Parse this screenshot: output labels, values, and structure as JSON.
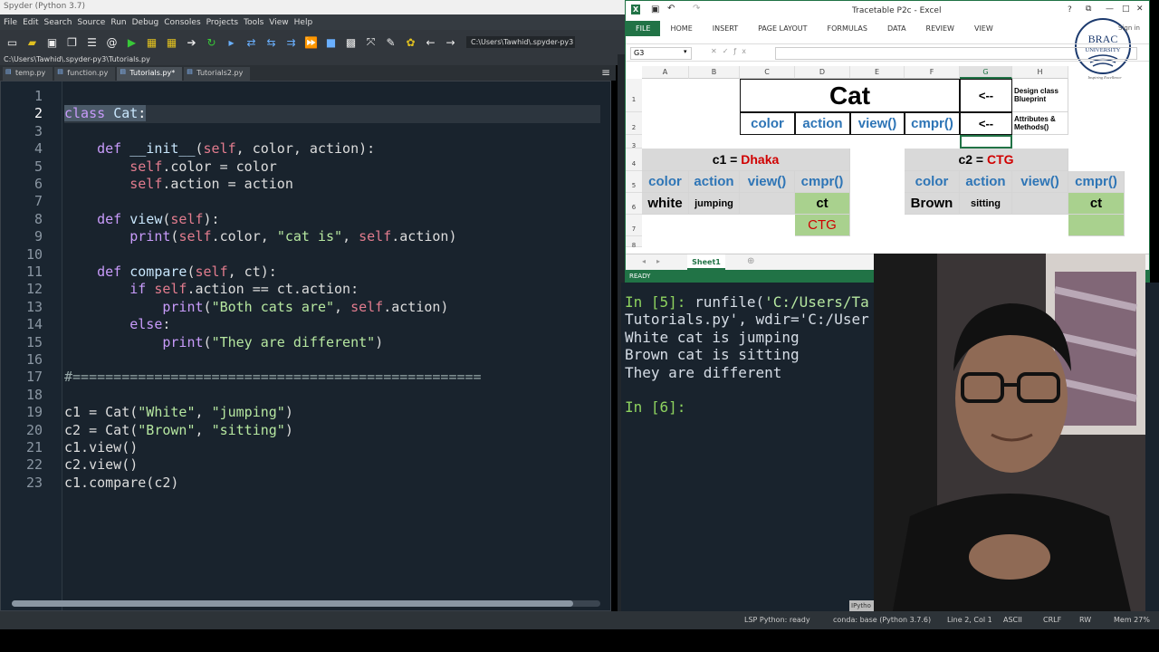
{
  "spyder": {
    "title": "Spyder (Python 3.7)",
    "menu": [
      "File",
      "Edit",
      "Search",
      "Source",
      "Run",
      "Debug",
      "Consoles",
      "Projects",
      "Tools",
      "View",
      "Help"
    ],
    "path_box": "C:\\Users\\Tawhid\\.spyder-py3",
    "file_path": "C:\\Users\\Tawhid\\.spyder-py3\\Tutorials.py",
    "tabs": [
      "temp.py",
      "function.py",
      "Tutorials.py*",
      "Tutorials2.py"
    ],
    "active_tab": 2,
    "code_lines": [
      "",
      "class Cat:",
      "",
      "    def __init__(self, color, action):",
      "        self.color = color",
      "        self.action = action",
      "",
      "    def view(self):",
      "        print(self.color, \"cat is\", self.action)",
      "",
      "    def compare(self, ct):",
      "        if self.action == ct.action:",
      "            print(\"Both cats are\", self.action)",
      "        else:",
      "            print(\"They are different\")",
      "",
      "#==================================================",
      "",
      "c1 = Cat(\"White\", \"jumping\")",
      "c2 = Cat(\"Brown\", \"sitting\")",
      "c1.view()",
      "c2.view()",
      "c1.compare(c2)"
    ],
    "current_line": 2,
    "status": {
      "lsp": "LSP Python: ready",
      "conda": "conda: base (Python 3.7.6)",
      "position": "Line 2, Col 1",
      "encoding": "ASCII",
      "eol": "CRLF",
      "rw": "RW",
      "mem": "Mem 27%"
    }
  },
  "excel": {
    "title": "Tracetable P2c - Excel",
    "signin": "Sign in",
    "ribbon": [
      "FILE",
      "HOME",
      "INSERT",
      "PAGE LAYOUT",
      "FORMULAS",
      "DATA",
      "REVIEW",
      "VIEW"
    ],
    "namebox": "G3",
    "columns": [
      "A",
      "B",
      "C",
      "D",
      "E",
      "F",
      "G",
      "H"
    ],
    "selected_column": "G",
    "rows": [
      "1",
      "2",
      "3",
      "4",
      "5",
      "6",
      "7",
      "8"
    ],
    "cells": {
      "cat": "Cat",
      "arrow1": "<--",
      "arrow2": "<--",
      "design": "Design class Blueprint",
      "attrs": "Attributes & Methods()",
      "color": "color",
      "action": "action",
      "view": "view()",
      "cmpr": "cmpr()",
      "c1_prefix": "c1 = ",
      "c1_city": "Dhaka",
      "c2_prefix": "c2 = ",
      "c2_city": "CTG",
      "white": "white",
      "jumping": "jumping",
      "ct": "ct",
      "ctg": "CTG",
      "brown": "Brown",
      "sitting": "sitting"
    },
    "sheet": "Sheet1",
    "status": "READY",
    "logo_text": "BRAC UNIVERSITY",
    "logo_tagline": "Inspiring Excellence"
  },
  "console": {
    "lines": [
      {
        "text": "In [5]: runfile('C:/Users/Ta",
        "prompt": true
      },
      {
        "text": "Tutorials.py', wdir='C:/User",
        "prompt": false
      },
      {
        "text": "White cat is jumping",
        "prompt": false
      },
      {
        "text": "Brown cat is sitting",
        "prompt": false
      },
      {
        "text": "They are different",
        "prompt": false
      },
      {
        "text": "",
        "prompt": false
      },
      {
        "text": "In [6]:",
        "prompt": true
      }
    ],
    "tab_label": "IPytho"
  },
  "colors": {
    "editor_bg": "#19232d",
    "excel_green": "#217346",
    "keyword": "#c89bfa",
    "string": "#b6e7a0"
  }
}
